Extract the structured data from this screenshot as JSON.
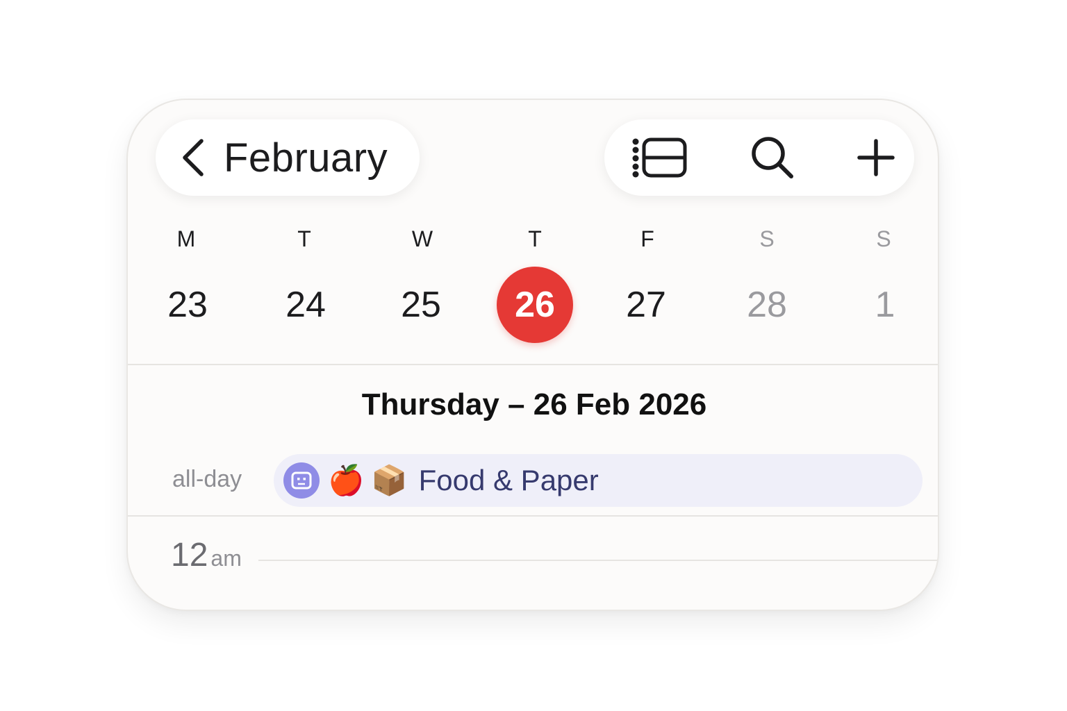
{
  "header": {
    "back_label": "February"
  },
  "week": {
    "weekdays": [
      {
        "label": "M",
        "weekend": false
      },
      {
        "label": "T",
        "weekend": false
      },
      {
        "label": "W",
        "weekend": false
      },
      {
        "label": "T",
        "weekend": false
      },
      {
        "label": "F",
        "weekend": false
      },
      {
        "label": "S",
        "weekend": true
      },
      {
        "label": "S",
        "weekend": true
      }
    ],
    "days": [
      {
        "label": "23",
        "weekend": false,
        "today": false
      },
      {
        "label": "24",
        "weekend": false,
        "today": false
      },
      {
        "label": "25",
        "weekend": false,
        "today": false
      },
      {
        "label": "26",
        "weekend": false,
        "today": true
      },
      {
        "label": "27",
        "weekend": false,
        "today": false
      },
      {
        "label": "28",
        "weekend": true,
        "today": false
      },
      {
        "label": "1",
        "weekend": true,
        "today": false
      }
    ]
  },
  "day_view": {
    "date_heading": "Thursday – 26 Feb 2026",
    "allday_label": "all-day",
    "event": {
      "emoji_1": "🍎",
      "emoji_2": "📦",
      "title": "Food & Paper",
      "badge_icon": "robot-face-icon"
    },
    "hour": {
      "num": "12",
      "ampm": "am"
    }
  },
  "icons": {
    "back": "chevron-left-icon",
    "list": "list-view-icon",
    "search": "search-icon",
    "add": "plus-icon"
  },
  "colors": {
    "today": "#e53935",
    "event_bg": "#efeff9",
    "event_text": "#363a6e",
    "badge": "#8f8ce6",
    "weekend_text": "#9a9a9e"
  }
}
